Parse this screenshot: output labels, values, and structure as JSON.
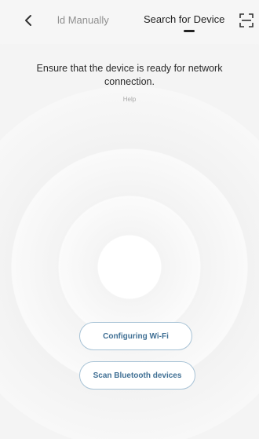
{
  "header": {
    "tabs": [
      {
        "label": "ld Manually",
        "active": false
      },
      {
        "label": "Search for Device",
        "active": true
      }
    ],
    "back_icon": "chevron-left-icon",
    "scan_icon": "scan-icon"
  },
  "main": {
    "instruction": "Ensure that the device is ready for network connection.",
    "help_link": "Help"
  },
  "actions": {
    "wifi_label": "Configuring Wi-Fi",
    "bluetooth_label": "Scan Bluetooth devices"
  },
  "colors": {
    "accent": "#3f6f94",
    "button_border": "#a8c3d6",
    "background": "#f6f6f6"
  }
}
